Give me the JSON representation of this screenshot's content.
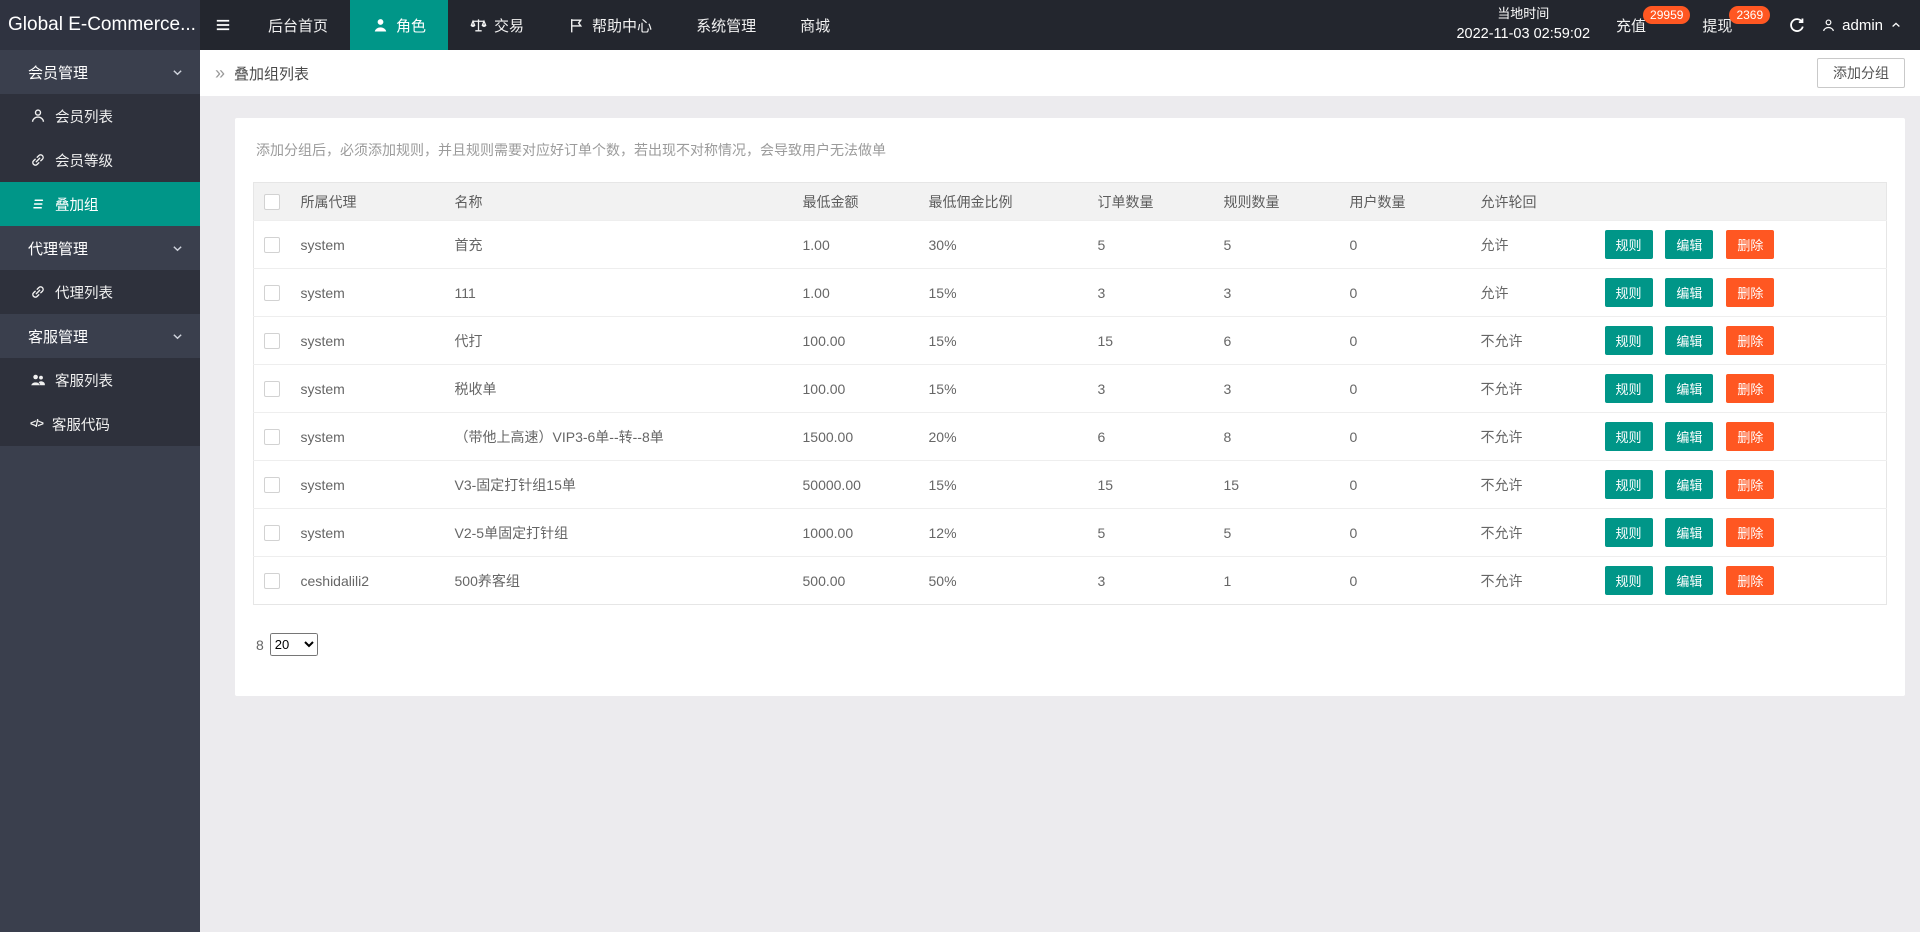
{
  "colors": {
    "accent": "#009688",
    "danger": "#FF5722",
    "navbar_bg": "#23262E",
    "sidebar_bg": "#3A3F4D",
    "sidebar_item_bg": "#2E313C"
  },
  "navbar": {
    "logo": "Global E-Commerce...",
    "menu": [
      {
        "label": "后台首页",
        "icon": null
      },
      {
        "label": "角色",
        "icon": "person-icon",
        "active": true
      },
      {
        "label": "交易",
        "icon": "scales-icon"
      },
      {
        "label": "帮助中心",
        "icon": "flag-icon"
      },
      {
        "label": "系统管理",
        "icon": null
      },
      {
        "label": "商城",
        "icon": null
      }
    ],
    "local_time_label": "当地时间",
    "local_time_value": "2022-11-03 02:59:02",
    "recharge_label": "充值",
    "recharge_badge": "29959",
    "withdraw_label": "提现",
    "withdraw_badge": "2369",
    "username": "admin"
  },
  "sidebar": {
    "groups": [
      {
        "label": "会员管理",
        "items": [
          {
            "label": "会员列表",
            "icon": "person-icon"
          },
          {
            "label": "会员等级",
            "icon": "link-icon"
          },
          {
            "label": "叠加组",
            "icon": "list-icon",
            "active": true
          }
        ]
      },
      {
        "label": "代理管理",
        "items": [
          {
            "label": "代理列表",
            "icon": "link-icon"
          }
        ]
      },
      {
        "label": "客服管理",
        "items": [
          {
            "label": "客服列表",
            "icon": "people-icon"
          },
          {
            "label": "客服代码",
            "icon": "code-icon",
            "code_glyph": "</>"
          }
        ]
      }
    ]
  },
  "page": {
    "breadcrumb_mark": "»",
    "breadcrumb": "叠加组列表",
    "add_group_button": "添加分组",
    "note": "添加分组后，必须添加规则，并且规则需要对应好订单个数，若出现不对称情况，会导致用户无法做单"
  },
  "table": {
    "columns": [
      "所属代理",
      "名称",
      "最低金额",
      "最低佣金比例",
      "订单数量",
      "规则数量",
      "用户数量",
      "允许轮回"
    ],
    "actions": [
      "规则",
      "编辑",
      "删除"
    ],
    "rows": [
      {
        "agent": "system",
        "name": "首充",
        "min_amount": "1.00",
        "min_commission": "30%",
        "orders": "5",
        "rules": "5",
        "users": "0",
        "loop": "允许"
      },
      {
        "agent": "system",
        "name": "111",
        "min_amount": "1.00",
        "min_commission": "15%",
        "orders": "3",
        "rules": "3",
        "users": "0",
        "loop": "允许"
      },
      {
        "agent": "system",
        "name": "代打",
        "min_amount": "100.00",
        "min_commission": "15%",
        "orders": "15",
        "rules": "6",
        "users": "0",
        "loop": "不允许"
      },
      {
        "agent": "system",
        "name": "税收单",
        "min_amount": "100.00",
        "min_commission": "15%",
        "orders": "3",
        "rules": "3",
        "users": "0",
        "loop": "不允许"
      },
      {
        "agent": "system",
        "name": "（带他上高速）VIP3-6单--转--8单",
        "min_amount": "1500.00",
        "min_commission": "20%",
        "orders": "6",
        "rules": "8",
        "users": "0",
        "loop": "不允许"
      },
      {
        "agent": "system",
        "name": "V3-固定打针组15单",
        "min_amount": "50000.00",
        "min_commission": "15%",
        "orders": "15",
        "rules": "15",
        "users": "0",
        "loop": "不允许"
      },
      {
        "agent": "system",
        "name": "V2-5单固定打针组",
        "min_amount": "1000.00",
        "min_commission": "12%",
        "orders": "5",
        "rules": "5",
        "users": "0",
        "loop": "不允许"
      },
      {
        "agent": "ceshidalili2",
        "name": "500养客组",
        "min_amount": "500.00",
        "min_commission": "50%",
        "orders": "3",
        "rules": "1",
        "users": "0",
        "loop": "不允许"
      }
    ]
  },
  "pagination": {
    "total": "8",
    "page_size": "20"
  }
}
